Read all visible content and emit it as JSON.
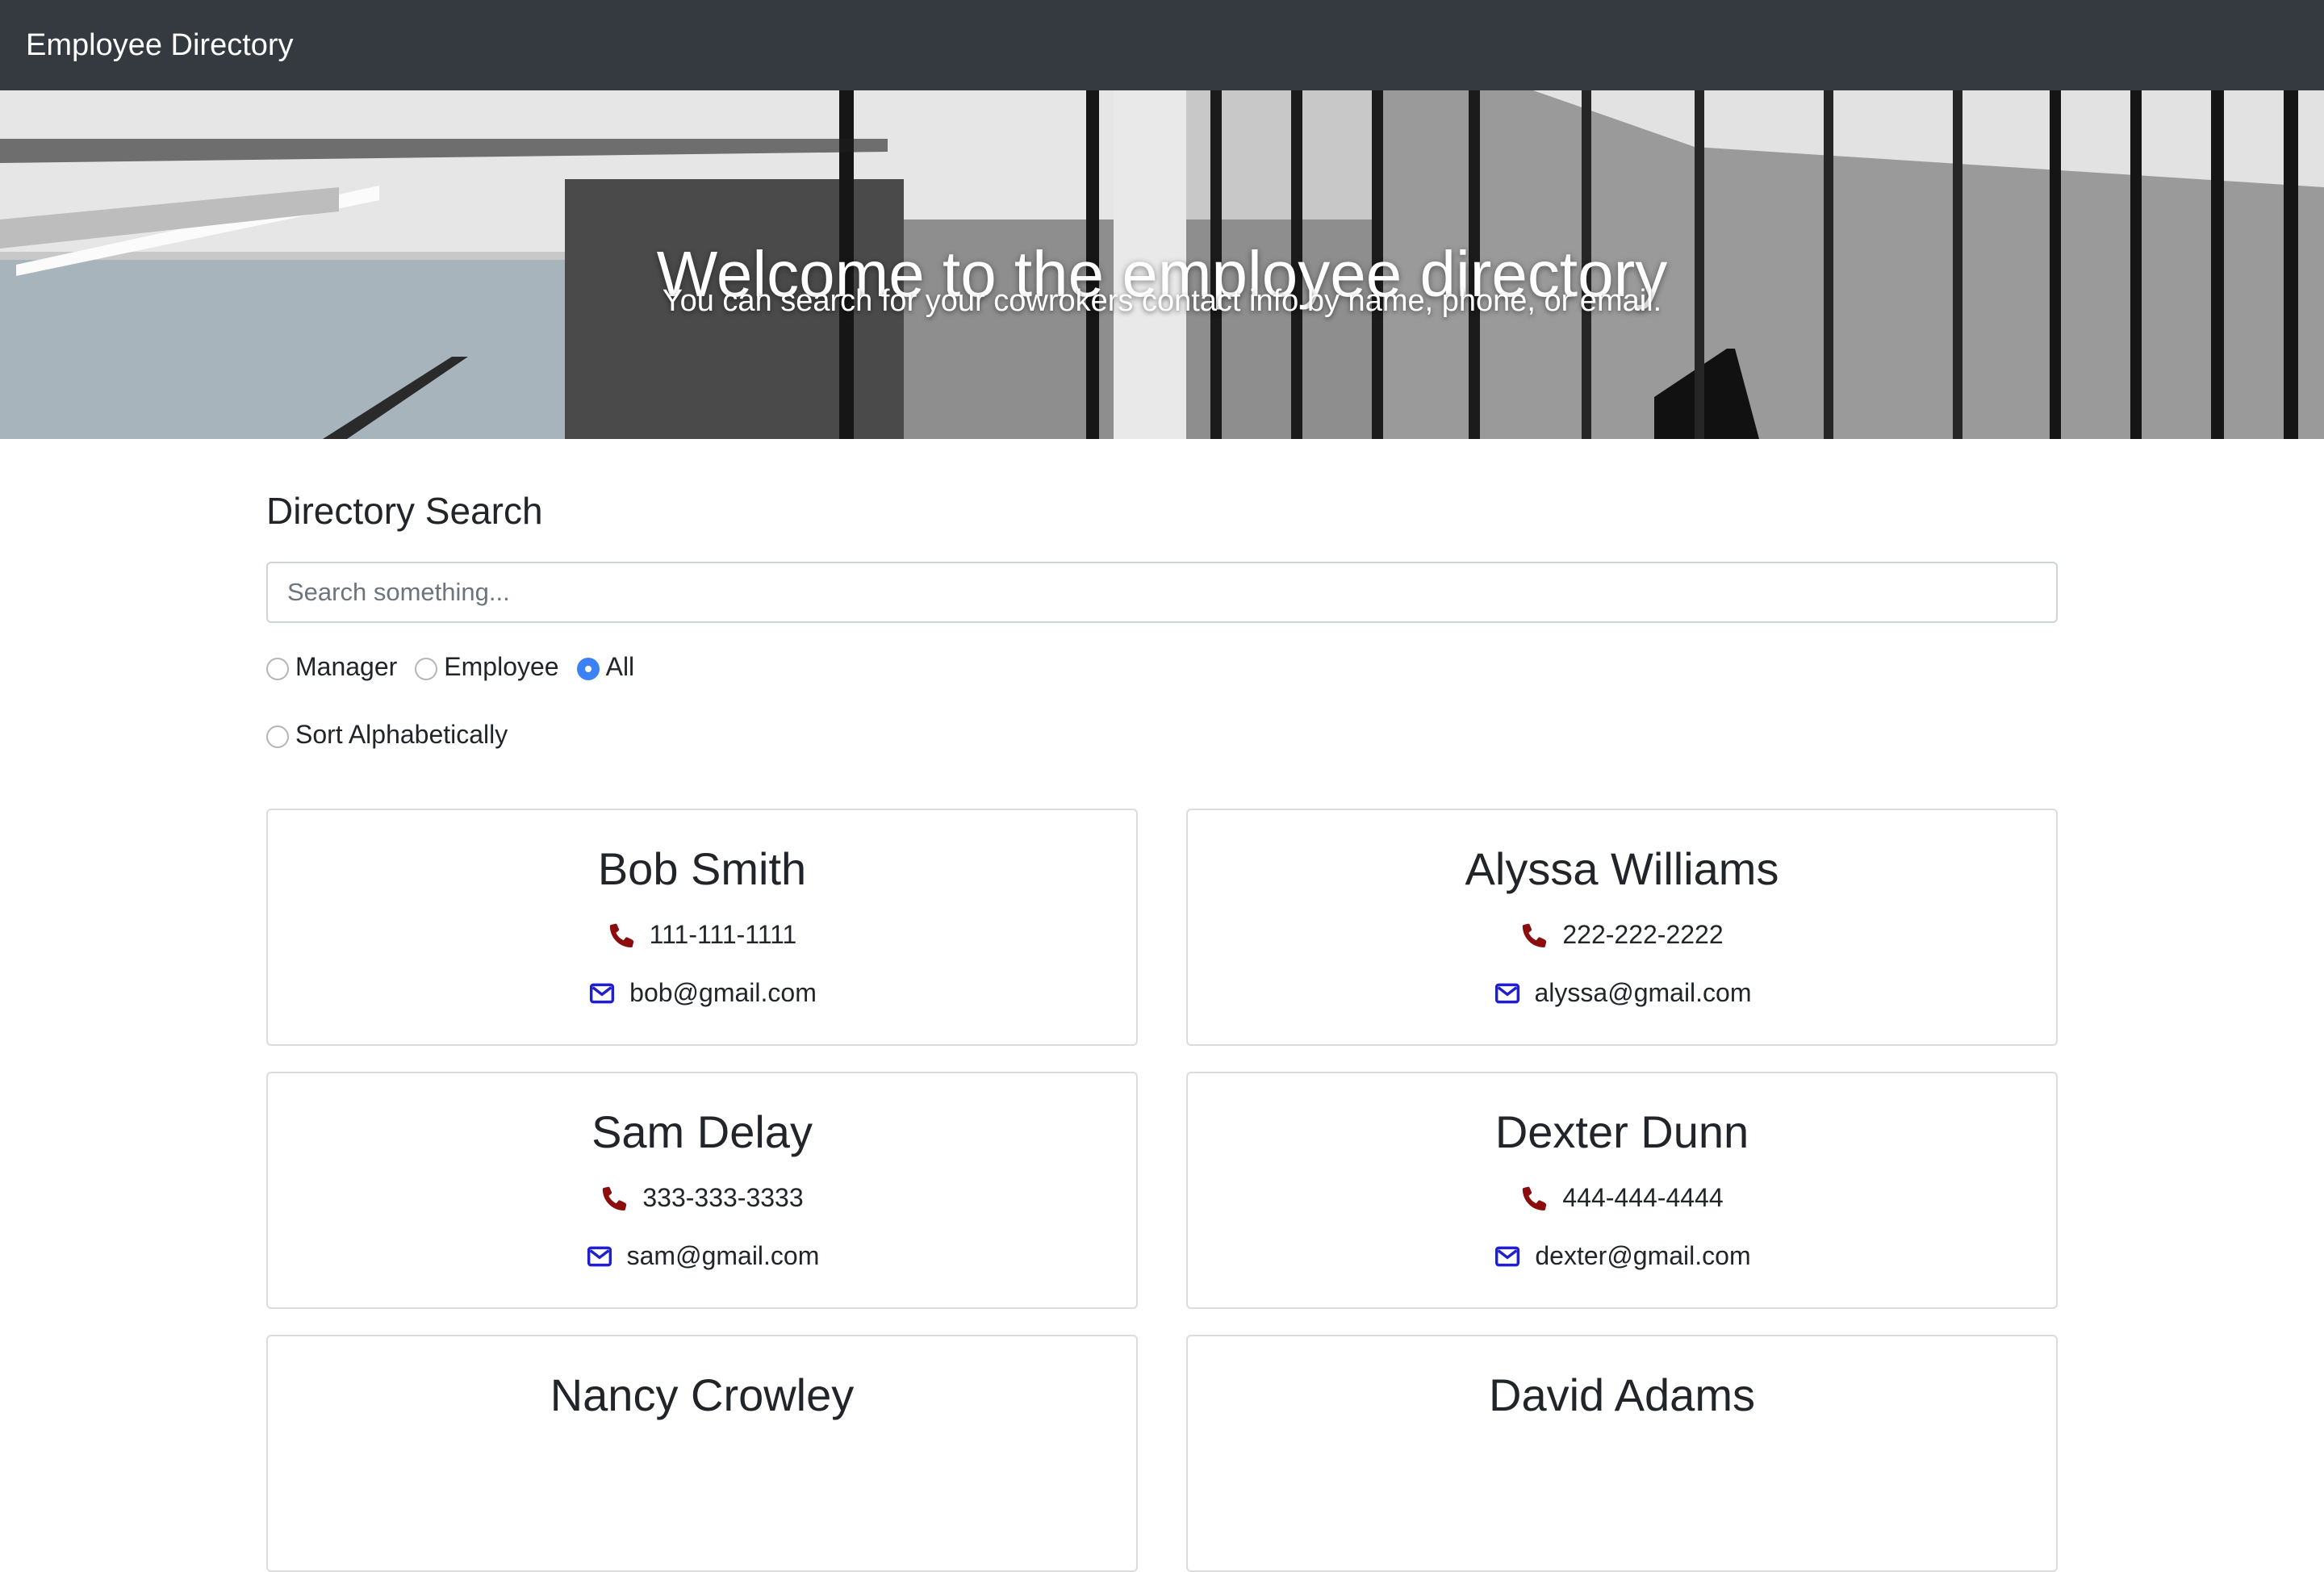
{
  "navbar": {
    "brand": "Employee Directory"
  },
  "hero": {
    "title": "Welcome to the employee directory",
    "subtitle": "You can search for your cowrokers contact info by name, phone, or email."
  },
  "search": {
    "heading": "Directory Search",
    "placeholder": "Search something...",
    "value": ""
  },
  "filters": {
    "options": [
      "Manager",
      "Employee",
      "All"
    ],
    "selected": "All",
    "sort_label": "Sort Alphabetically",
    "sort_checked": false
  },
  "colors": {
    "navbar_bg": "#343a40",
    "phone_icon": "#8b0d0d",
    "email_icon": "#1f1fd1",
    "radio_accent": "#3b82f6"
  },
  "icons": {
    "phone": "phone-icon",
    "email": "envelope-icon"
  },
  "employees": [
    {
      "name": "Bob Smith",
      "phone": "111-111-1111",
      "email": "bob@gmail.com"
    },
    {
      "name": "Alyssa Williams",
      "phone": "222-222-2222",
      "email": "alyssa@gmail.com"
    },
    {
      "name": "Sam Delay",
      "phone": "333-333-3333",
      "email": "sam@gmail.com"
    },
    {
      "name": "Dexter Dunn",
      "phone": "444-444-4444",
      "email": "dexter@gmail.com"
    },
    {
      "name": "Nancy Crowley",
      "phone": "",
      "email": ""
    },
    {
      "name": "David Adams",
      "phone": "",
      "email": ""
    }
  ]
}
